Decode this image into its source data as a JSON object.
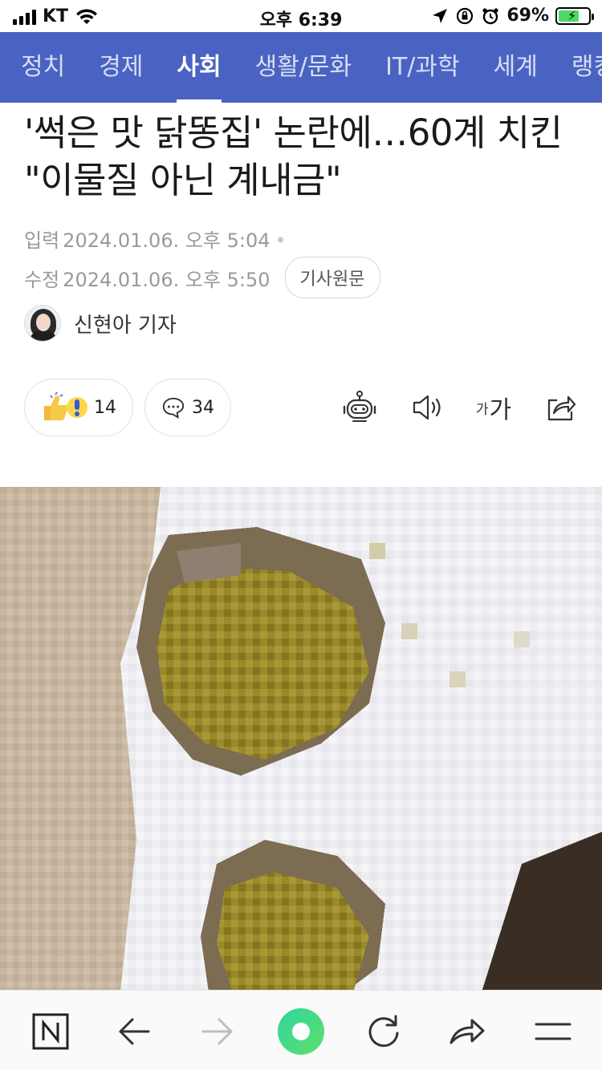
{
  "status_bar": {
    "carrier": "KT",
    "time": "오후 6:39",
    "battery_percent": "69%",
    "battery_level": 0.69
  },
  "categories": {
    "items": [
      {
        "label": "정치"
      },
      {
        "label": "경제"
      },
      {
        "label": "사회"
      },
      {
        "label": "생활/문화"
      },
      {
        "label": "IT/과학"
      },
      {
        "label": "세계"
      },
      {
        "label": "랭킹"
      }
    ],
    "active_index": 2
  },
  "article": {
    "headline": "'썩은 맛 닭똥집' 논란에…60계 치킨 \"이물질 아닌 계내금\"",
    "input_label": "입력",
    "input_time": "2024.01.06. 오후 5:04",
    "edit_label": "수정",
    "edit_time": "2024.01.06. 오후 5:50",
    "original_button": "기사원문",
    "reporter": "신현아 기자"
  },
  "actions": {
    "reaction_count": "14",
    "comment_count": "34",
    "font_small": "가",
    "font_large": "가"
  },
  "colors": {
    "nav_bg": "#4a63c3",
    "browser_green": "#3cd2a0"
  },
  "bottom_bar": {
    "icons": [
      "naver-n-icon",
      "back-arrow-icon",
      "forward-arrow-icon",
      "green-dot-icon",
      "refresh-icon",
      "share-icon",
      "menu-icon"
    ]
  }
}
